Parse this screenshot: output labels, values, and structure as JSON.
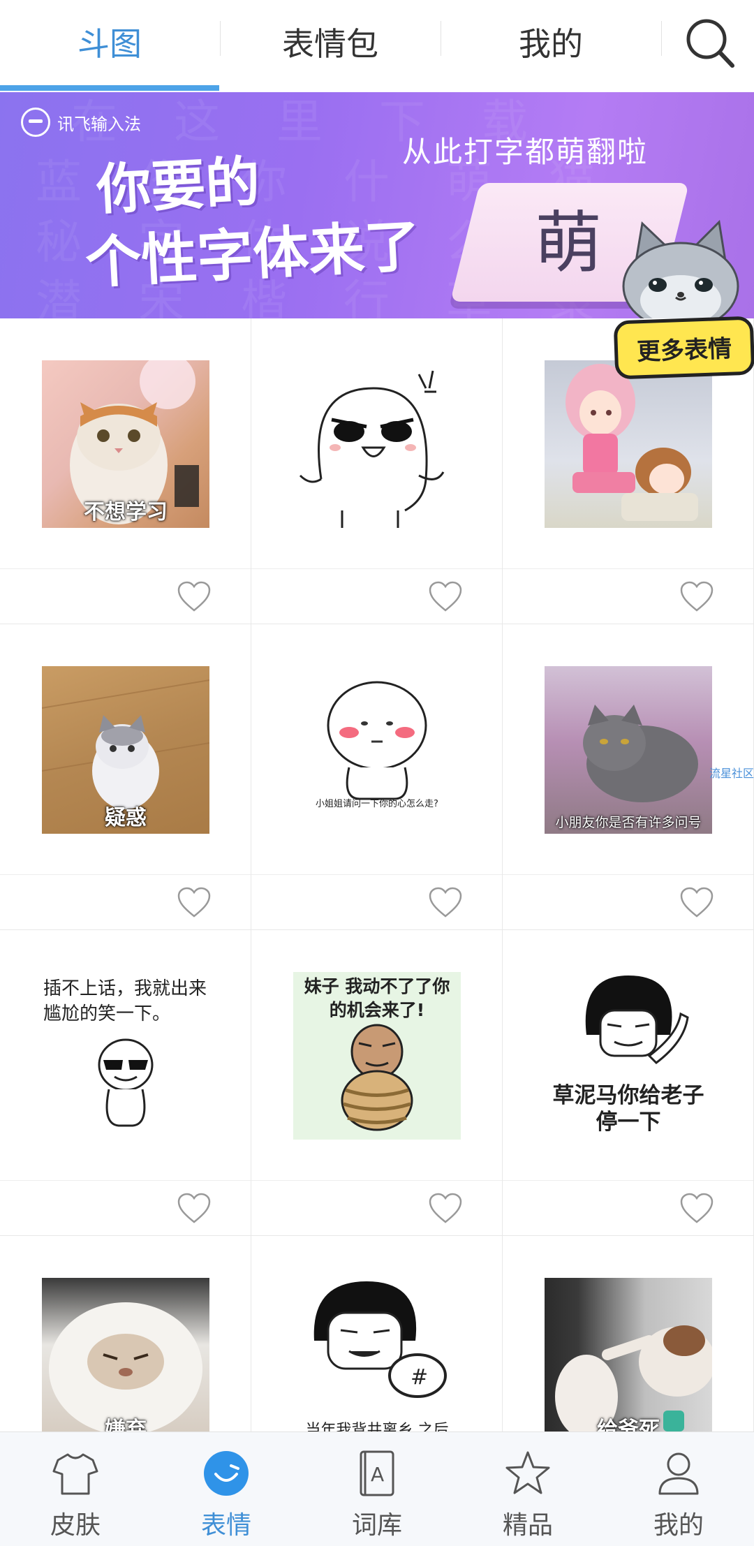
{
  "top_tabs": [
    {
      "label": "斗图",
      "active": true
    },
    {
      "label": "表情包",
      "active": false
    },
    {
      "label": "我的",
      "active": false
    }
  ],
  "search": {
    "icon": "search-icon"
  },
  "banner": {
    "brand": "讯飞输入法",
    "headline_1": "你要的",
    "headline_2": "个性字体来了",
    "slogan": "从此打字都萌翻啦",
    "card_char": "萌",
    "more_button": "更多表情"
  },
  "grid": {
    "items": [
      {
        "caption": "不想学习",
        "type": "photo",
        "subject": "cat"
      },
      {
        "caption": "",
        "type": "drawing",
        "subject": "angry-blob"
      },
      {
        "caption": "",
        "type": "drawing",
        "subject": "anime-girls"
      },
      {
        "caption": "疑惑",
        "type": "photo",
        "subject": "kitten"
      },
      {
        "caption": "小姐姐请问一下你的心怎么走?",
        "type": "drawing",
        "subject": "blush-blob"
      },
      {
        "caption": "小朋友你是否有许多问号",
        "type": "photo",
        "subject": "grey-cat"
      },
      {
        "caption": "插不上话，我就出来尴尬的笑一下。",
        "type": "drawing",
        "subject": "sunglasses-blob"
      },
      {
        "caption": "妹子 我动不了了你的机会来了!",
        "type": "drawing",
        "subject": "tied-man"
      },
      {
        "caption": "草泥马你给老子停一下",
        "type": "drawing",
        "subject": "bowl-cut"
      },
      {
        "caption": "嫌弃",
        "type": "photo",
        "subject": "fluffy-cat"
      },
      {
        "caption": "当年我背井离乡 之后",
        "type": "drawing",
        "subject": "bowl-cut-cup"
      },
      {
        "caption": "给爷死",
        "type": "photo",
        "subject": "cats-fighting"
      }
    ],
    "like_icon": "heart-outline-icon",
    "watermark": "流星社区"
  },
  "bottom_nav": [
    {
      "label": "皮肤",
      "icon": "tshirt-icon",
      "active": false
    },
    {
      "label": "表情",
      "icon": "smiley-icon",
      "active": true
    },
    {
      "label": "词库",
      "icon": "dictionary-icon",
      "active": false
    },
    {
      "label": "精品",
      "icon": "star-icon",
      "active": false
    },
    {
      "label": "我的",
      "icon": "user-icon",
      "active": false
    }
  ],
  "colors": {
    "accent": "#3f8fd6",
    "banner": "#9a6ff1",
    "more_button": "#ffe650"
  }
}
